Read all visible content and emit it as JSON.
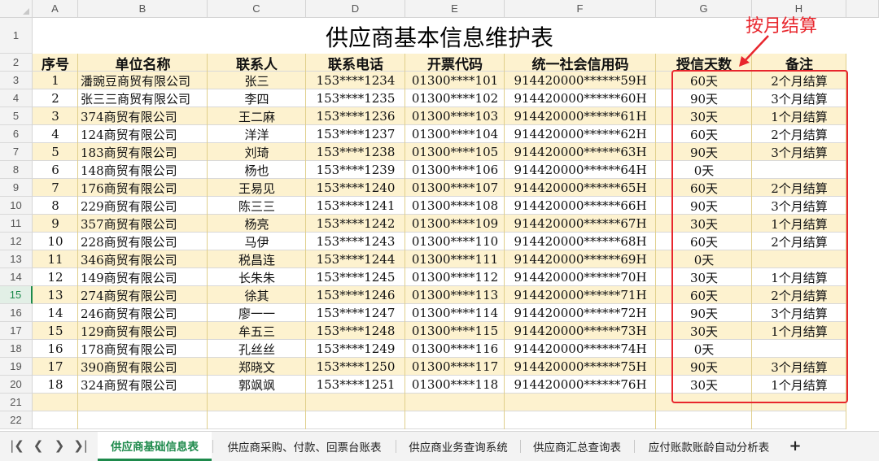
{
  "sheet": {
    "columns": [
      "A",
      "B",
      "C",
      "D",
      "E",
      "F",
      "G",
      "H"
    ],
    "row_numbers": [
      "1",
      "2",
      "3",
      "4",
      "5",
      "6",
      "7",
      "8",
      "9",
      "10",
      "11",
      "12",
      "13",
      "14",
      "15",
      "16",
      "17",
      "18",
      "19",
      "20",
      "21",
      "22"
    ],
    "active_row": "15",
    "title": "供应商基本信息维护表",
    "headers": [
      "序号",
      "单位名称",
      "联系人",
      "联系电话",
      "开票代码",
      "统一社会信用码",
      "授信天数",
      "备注"
    ],
    "rows": [
      [
        "1",
        "潘豌豆商贸有限公司",
        "张三",
        "153****1234",
        "01300****101",
        "914420000******59H",
        "60天",
        "2个月结算"
      ],
      [
        "2",
        "张三三商贸有限公司",
        "李四",
        "153****1235",
        "01300****102",
        "914420000******60H",
        "90天",
        "3个月结算"
      ],
      [
        "3",
        "374商贸有限公司",
        "王二麻",
        "153****1236",
        "01300****103",
        "914420000******61H",
        "30天",
        "1个月结算"
      ],
      [
        "4",
        "124商贸有限公司",
        "洋洋",
        "153****1237",
        "01300****104",
        "914420000******62H",
        "60天",
        "2个月结算"
      ],
      [
        "5",
        "183商贸有限公司",
        "刘琦",
        "153****1238",
        "01300****105",
        "914420000******63H",
        "90天",
        "3个月结算"
      ],
      [
        "6",
        "148商贸有限公司",
        "杨也",
        "153****1239",
        "01300****106",
        "914420000******64H",
        "0天",
        ""
      ],
      [
        "7",
        "176商贸有限公司",
        "王易见",
        "153****1240",
        "01300****107",
        "914420000******65H",
        "60天",
        "2个月结算"
      ],
      [
        "8",
        "229商贸有限公司",
        "陈三三",
        "153****1241",
        "01300****108",
        "914420000******66H",
        "90天",
        "3个月结算"
      ],
      [
        "9",
        "357商贸有限公司",
        "杨亮",
        "153****1242",
        "01300****109",
        "914420000******67H",
        "30天",
        "1个月结算"
      ],
      [
        "10",
        "228商贸有限公司",
        "马伊",
        "153****1243",
        "01300****110",
        "914420000******68H",
        "60天",
        "2个月结算"
      ],
      [
        "11",
        "346商贸有限公司",
        "税昌连",
        "153****1244",
        "01300****111",
        "914420000******69H",
        "0天",
        ""
      ],
      [
        "12",
        "149商贸有限公司",
        "长朱朱",
        "153****1245",
        "01300****112",
        "914420000******70H",
        "30天",
        "1个月结算"
      ],
      [
        "13",
        "274商贸有限公司",
        "徐其",
        "153****1246",
        "01300****113",
        "914420000******71H",
        "60天",
        "2个月结算"
      ],
      [
        "14",
        "246商贸有限公司",
        "廖一一",
        "153****1247",
        "01300****114",
        "914420000******72H",
        "90天",
        "3个月结算"
      ],
      [
        "15",
        "129商贸有限公司",
        "牟五三",
        "153****1248",
        "01300****115",
        "914420000******73H",
        "30天",
        "1个月结算"
      ],
      [
        "16",
        "178商贸有限公司",
        "孔丝丝",
        "153****1249",
        "01300****116",
        "914420000******74H",
        "0天",
        ""
      ],
      [
        "17",
        "390商贸有限公司",
        "郑晓文",
        "153****1250",
        "01300****117",
        "914420000******75H",
        "90天",
        "3个月结算"
      ],
      [
        "18",
        "324商贸有限公司",
        "郭飒飒",
        "153****1251",
        "01300****118",
        "914420000******76H",
        "30天",
        "1个月结算"
      ]
    ]
  },
  "annotation": {
    "label": "按月结算",
    "color": "#e8262d"
  },
  "tabbar": {
    "nav_icons": [
      "first-sheet-icon",
      "prev-sheet-icon",
      "next-sheet-icon",
      "last-sheet-icon"
    ],
    "tabs": [
      "供应商基础信息表",
      "供应商采购、付款、回票台账表",
      "供应商业务查询系统",
      "供应商汇总查询表",
      "应付账款账龄自动分析表"
    ],
    "active_tab": "供应商基础信息表",
    "add_label": "+"
  },
  "colors": {
    "band_yellow": "#fdf2cf",
    "accent_green": "#1e8a4c"
  }
}
